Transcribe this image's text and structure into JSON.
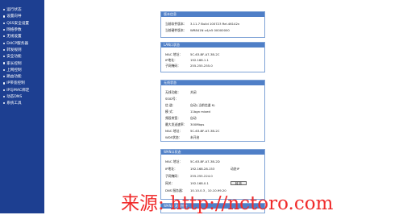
{
  "sidebar": {
    "items": [
      {
        "label": "运行状态"
      },
      {
        "label": "设置向导"
      },
      {
        "label": "QSS安全设置"
      },
      {
        "label": "网络参数"
      },
      {
        "label": "无线设置"
      },
      {
        "label": "DHCP服务器"
      },
      {
        "label": "转发规则"
      },
      {
        "label": "安全功能"
      },
      {
        "label": "家长控制"
      },
      {
        "label": "上网控制"
      },
      {
        "label": "路由功能"
      },
      {
        "label": "IP带宽控制"
      },
      {
        "label": "IP与MAC绑定"
      },
      {
        "label": "动态DNS"
      },
      {
        "label": "系统工具"
      }
    ]
  },
  "panels": {
    "version": {
      "title": "版本信息",
      "rows": [
        {
          "k": "当前软件版本：",
          "v": "3.11.7 Build 100723 Rel.46142n"
        },
        {
          "k": "当前硬件版本：",
          "v": "WR841N v4/v5 00000000"
        }
      ]
    },
    "lan": {
      "title": "LAN口状态",
      "rows": [
        {
          "k": "MAC 地址：",
          "v": "5C-63-BF-A7-3B-2C"
        },
        {
          "k": "IP地址：",
          "v": "192.168.1.1"
        },
        {
          "k": "子网掩码：",
          "v": "255.255.255.0"
        }
      ]
    },
    "wireless": {
      "title": "无线状态",
      "rows": [
        {
          "k": "无线功能：",
          "v": "关闭"
        },
        {
          "k": "SSID号：",
          "v": ""
        },
        {
          "k": "信 道：",
          "v": "自动( 当前信道 6)"
        },
        {
          "k": "模 式：",
          "v": "11bgn mixed"
        },
        {
          "k": "频段带宽：",
          "v": "自动"
        },
        {
          "k": "最大发送速率：",
          "v": "300Mbps"
        },
        {
          "k": "MAC 地址：",
          "v": "5C-63-BF-A7-3B-2C"
        },
        {
          "k": "WDS状态：",
          "v": "未开启"
        }
      ]
    },
    "wan": {
      "title": "WAN口状态",
      "rows": [
        {
          "k": "MAC 地址：",
          "v": "5C-63-BF-A7-3B-2D"
        },
        {
          "k": "IP地址：",
          "v": "192.168.28.153",
          "x": "动态IP"
        },
        {
          "k": "子网掩码：",
          "v": "255.255.224.0"
        },
        {
          "k": "网关：",
          "v": "192.168.0.1",
          "btn": "释 放"
        },
        {
          "k": "DNS 服务器：",
          "v": "10.10.0.3 , 10.10.99.20"
        }
      ]
    },
    "traffic": {
      "title": "WAN口流量统计"
    }
  },
  "watermark": {
    "text": "来源: http://nctoro.com"
  }
}
